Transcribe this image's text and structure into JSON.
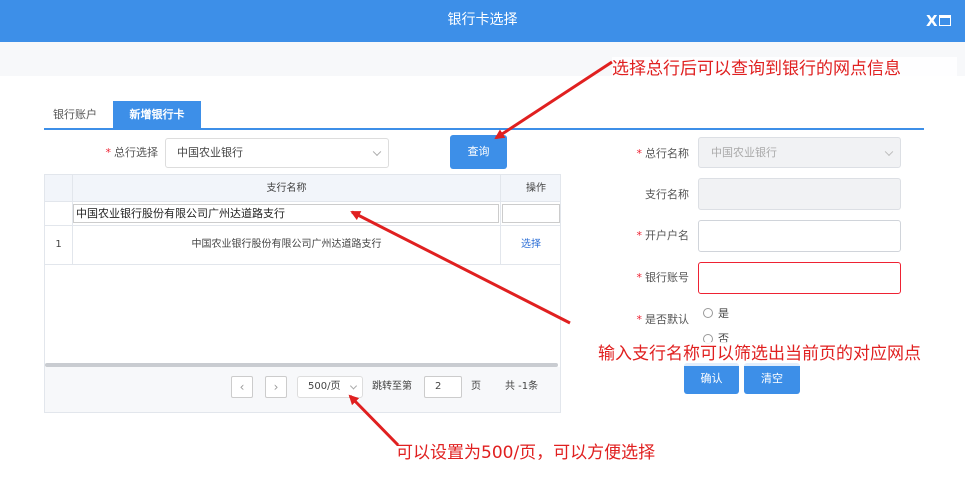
{
  "window": {
    "title": "银行卡选择",
    "close_label": "X"
  },
  "tabs": [
    {
      "label": "银行账户"
    },
    {
      "label": "新增银行卡"
    }
  ],
  "search": {
    "bank_label": "总行选择",
    "bank_value": "中国农业银行",
    "query_button": "查询"
  },
  "table": {
    "columns": [
      "支行名称",
      "操作"
    ],
    "filter_value": "中国农业银行股份有限公司广州达道路支行",
    "rows": [
      {
        "index": "1",
        "name": "中国农业银行股份有限公司广州达道路支行",
        "action": "选择"
      }
    ]
  },
  "pager": {
    "prev": "‹",
    "next": "›",
    "page_size": "500/页",
    "jump_label": "跳转至第",
    "jump_value": "2",
    "page_unit": "页",
    "total": "共 -1条"
  },
  "form": {
    "bank_name_label": "总行名称",
    "bank_name_value": "中国农业银行",
    "branch_name_label": "支行名称",
    "account_holder_label": "开户户名",
    "account_number_label": "银行账号",
    "default_label": "是否默认",
    "default_yes": "是",
    "default_no": "否",
    "confirm_button": "确认",
    "clear_button": "清空"
  },
  "annotations": {
    "note_top": "选择总行后可以查询到银行的网点信息",
    "note_middle": "输入支行名称可以筛选出当前页的对应网点",
    "note_bottom": "可以设置为500/页，可以方便选择"
  },
  "colors": {
    "primary": "#3d8fe8",
    "annotation": "#e02020",
    "required": "#e22233"
  }
}
